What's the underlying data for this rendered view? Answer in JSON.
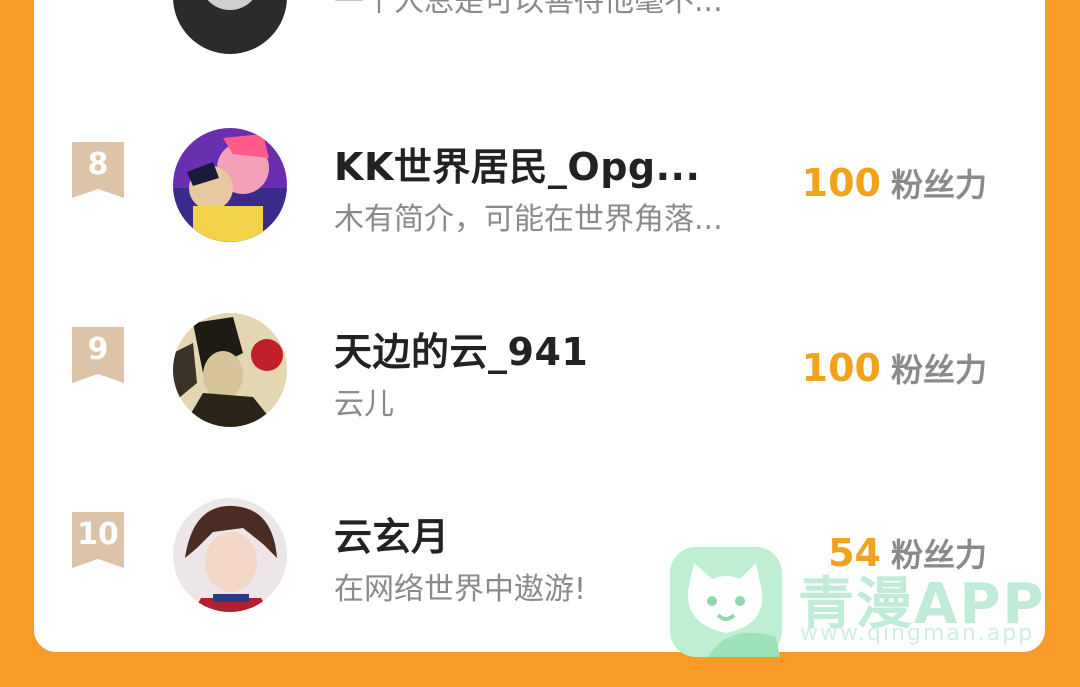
{
  "rows": [
    {
      "rank": "",
      "name": "",
      "bio": "一个人总是可以善待他毫不...",
      "score": "",
      "unit": ""
    },
    {
      "rank": "8",
      "name": "KK世界居民_Opg...",
      "bio": "木有简介，可能在世界角落...",
      "score": "100",
      "unit": "粉丝力"
    },
    {
      "rank": "9",
      "name": "天边的云_941",
      "bio": "云儿",
      "score": "100",
      "unit": "粉丝力"
    },
    {
      "rank": "10",
      "name": "云玄月",
      "bio": "在网络世界中遨游!",
      "score": "54",
      "unit": "粉丝力"
    }
  ],
  "watermark": {
    "title": "青漫APP",
    "url": "www.qingman.app"
  },
  "colors": {
    "page_bg": "#FA9A28",
    "card_bg": "#FFFFFF",
    "score": "#F2A31E",
    "rank_badge": "#DDC3A8"
  }
}
